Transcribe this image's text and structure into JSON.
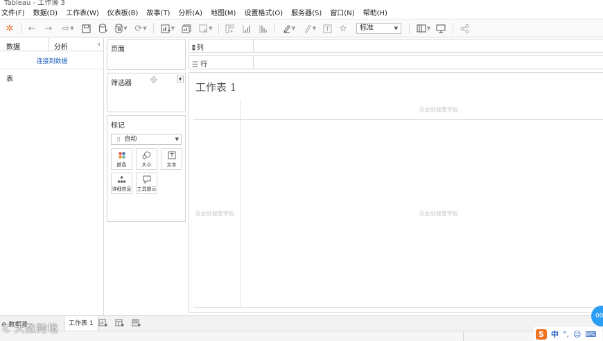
{
  "window": {
    "title": "Tableau - 工作簿 3"
  },
  "menu": [
    "文件(F)",
    "数据(D)",
    "工作表(W)",
    "仪表板(B)",
    "故事(T)",
    "分析(A)",
    "地图(M)",
    "设置格式(O)",
    "服务器(S)",
    "窗口(N)",
    "帮助(H)"
  ],
  "toolbar": {
    "fit_select": "标准"
  },
  "left_pane": {
    "tab_data": "数据",
    "tab_analysis": "分析",
    "connect_link": "连接到数据",
    "tables_label": "表"
  },
  "cards": {
    "pages": "页面",
    "filters": "筛选器",
    "marks": "标记",
    "mark_type": "自动",
    "mark_buttons": [
      "颜色",
      "大小",
      "文本",
      "详细信息",
      "工具提示"
    ]
  },
  "shelves": {
    "columns": "列",
    "rows": "行"
  },
  "canvas": {
    "sheet_title": "工作表 1",
    "drop_field_top": "在此处放置字段",
    "drop_field_left": "在此处放置字段",
    "drop_field_center": "在此处放置字段"
  },
  "tabs": {
    "datasource": "数据源",
    "sheet": "工作表 1"
  },
  "ime": {
    "lang": "中"
  },
  "watermark": "大数跨境",
  "bubble": "00",
  "colors": {
    "link": "#1f5fbf",
    "accent": "#2a9df4"
  }
}
